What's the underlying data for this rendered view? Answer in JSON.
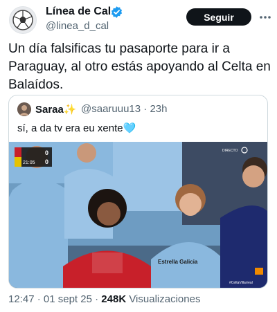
{
  "author": {
    "name": "Línea de Cal",
    "handle": "@linea_d_cal",
    "avatar": "soccer-ball-logo",
    "verified_color": "#1d9bf0"
  },
  "follow_label": "Seguir",
  "more_icon": "more-options-icon",
  "tweet_text": "Un día falsificas tu pasaporte para ir a Paraguay, al otro estás apoyando al Celta en Balaídos.",
  "quote": {
    "name": "Saraa",
    "name_emoji": "✨",
    "handle": "@saaruuu13",
    "separator": "·",
    "time": "23h",
    "text": "sí, a da tv era eu xente",
    "text_emoji": "🩵"
  },
  "broadcast": {
    "scoreboard_time": "21:05",
    "home_score": "0",
    "away_score": "0",
    "channel_mark": "DIRECTO",
    "sponsor_text": "Estrella Galicia",
    "hashtag": "#CeltaVillarreal"
  },
  "footer": {
    "time": "12:47",
    "separator": "·",
    "date": "01 sept 25",
    "separator2": "·",
    "views": "248K",
    "views_label": "Visualizaciones"
  },
  "colors": {
    "text": "#0f1419",
    "muted": "#536471",
    "border": "#cfd9de",
    "follow_bg": "#0f1419",
    "celta_blue": "#8ab8de"
  }
}
